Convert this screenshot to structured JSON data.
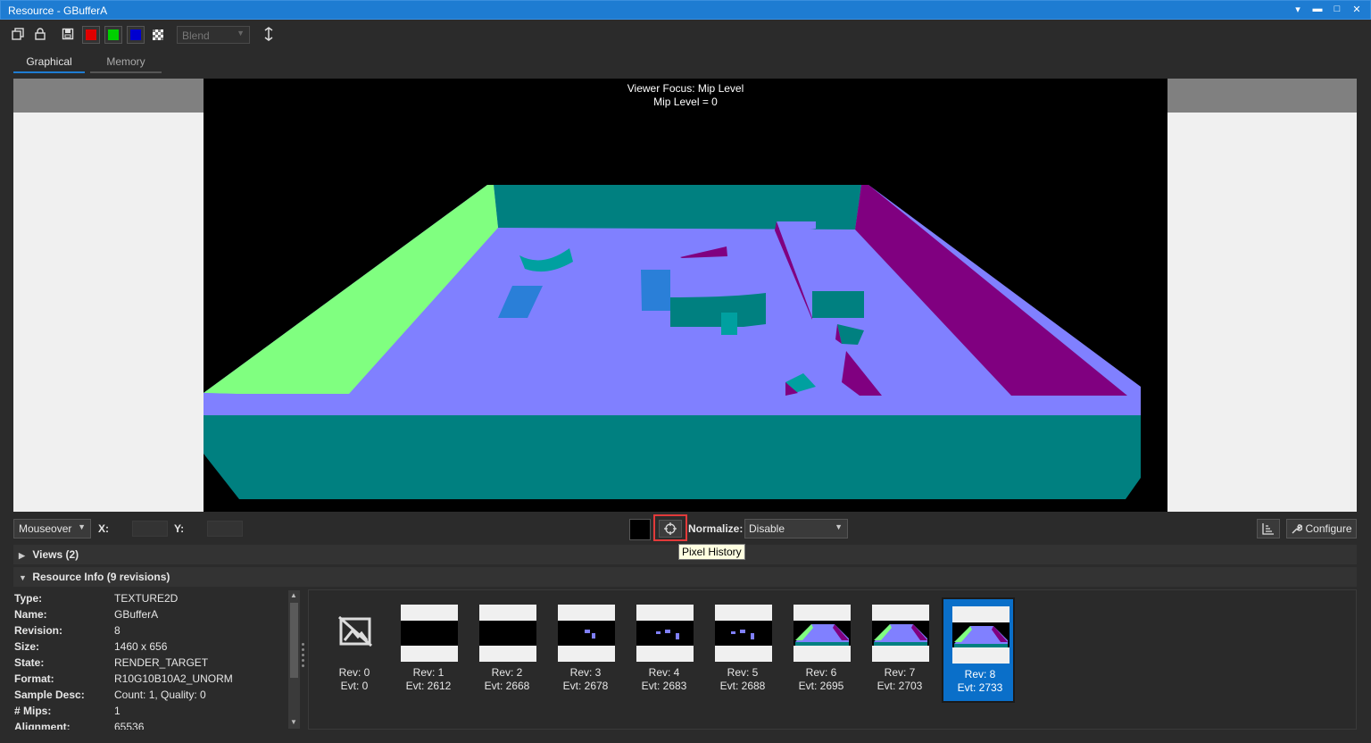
{
  "window": {
    "title": "Resource - GBufferA"
  },
  "toolbar": {
    "blend_value": "Blend"
  },
  "tabs": [
    {
      "label": "Graphical"
    },
    {
      "label": "Memory"
    }
  ],
  "viewer": {
    "focus_line1": "Viewer Focus: Mip Level",
    "focus_line2": "Mip Level = 0"
  },
  "status": {
    "mode": "Mouseover",
    "x_label": "X:",
    "y_label": "Y:",
    "tooltip": "Pixel History",
    "normalize_label": "Normalize:",
    "normalize_value": "Disable",
    "configure_label": "Configure"
  },
  "sections": {
    "views": "Views (2)",
    "resource_info": "Resource Info (9 revisions)"
  },
  "info": [
    {
      "k": "Type:",
      "v": "TEXTURE2D"
    },
    {
      "k": "Name:",
      "v": "GBufferA"
    },
    {
      "k": "Revision:",
      "v": "8"
    },
    {
      "k": "Size:",
      "v": "1460 x 656"
    },
    {
      "k": "State:",
      "v": "RENDER_TARGET"
    },
    {
      "k": "Format:",
      "v": "R10G10B10A2_UNORM"
    },
    {
      "k": "Sample Desc:",
      "v": "Count: 1, Quality: 0"
    },
    {
      "k": "# Mips:",
      "v": "1"
    },
    {
      "k": "Alignment:",
      "v": "65536"
    }
  ],
  "revisions": [
    {
      "rev": "Rev: 0",
      "evt": "Evt: 0"
    },
    {
      "rev": "Rev: 1",
      "evt": "Evt: 2612"
    },
    {
      "rev": "Rev: 2",
      "evt": "Evt: 2668"
    },
    {
      "rev": "Rev: 3",
      "evt": "Evt: 2678"
    },
    {
      "rev": "Rev: 4",
      "evt": "Evt: 2683"
    },
    {
      "rev": "Rev: 5",
      "evt": "Evt: 2688"
    },
    {
      "rev": "Rev: 6",
      "evt": "Evt: 2695"
    },
    {
      "rev": "Rev: 7",
      "evt": "Evt: 2703"
    },
    {
      "rev": "Rev: 8",
      "evt": "Evt: 2733"
    }
  ],
  "colors": {
    "accent": "#1e7cd2",
    "floor": "#8080ff",
    "teal": "#008080",
    "green": "#80ff80",
    "purple": "#800080",
    "highlight": "#e23a3a"
  }
}
